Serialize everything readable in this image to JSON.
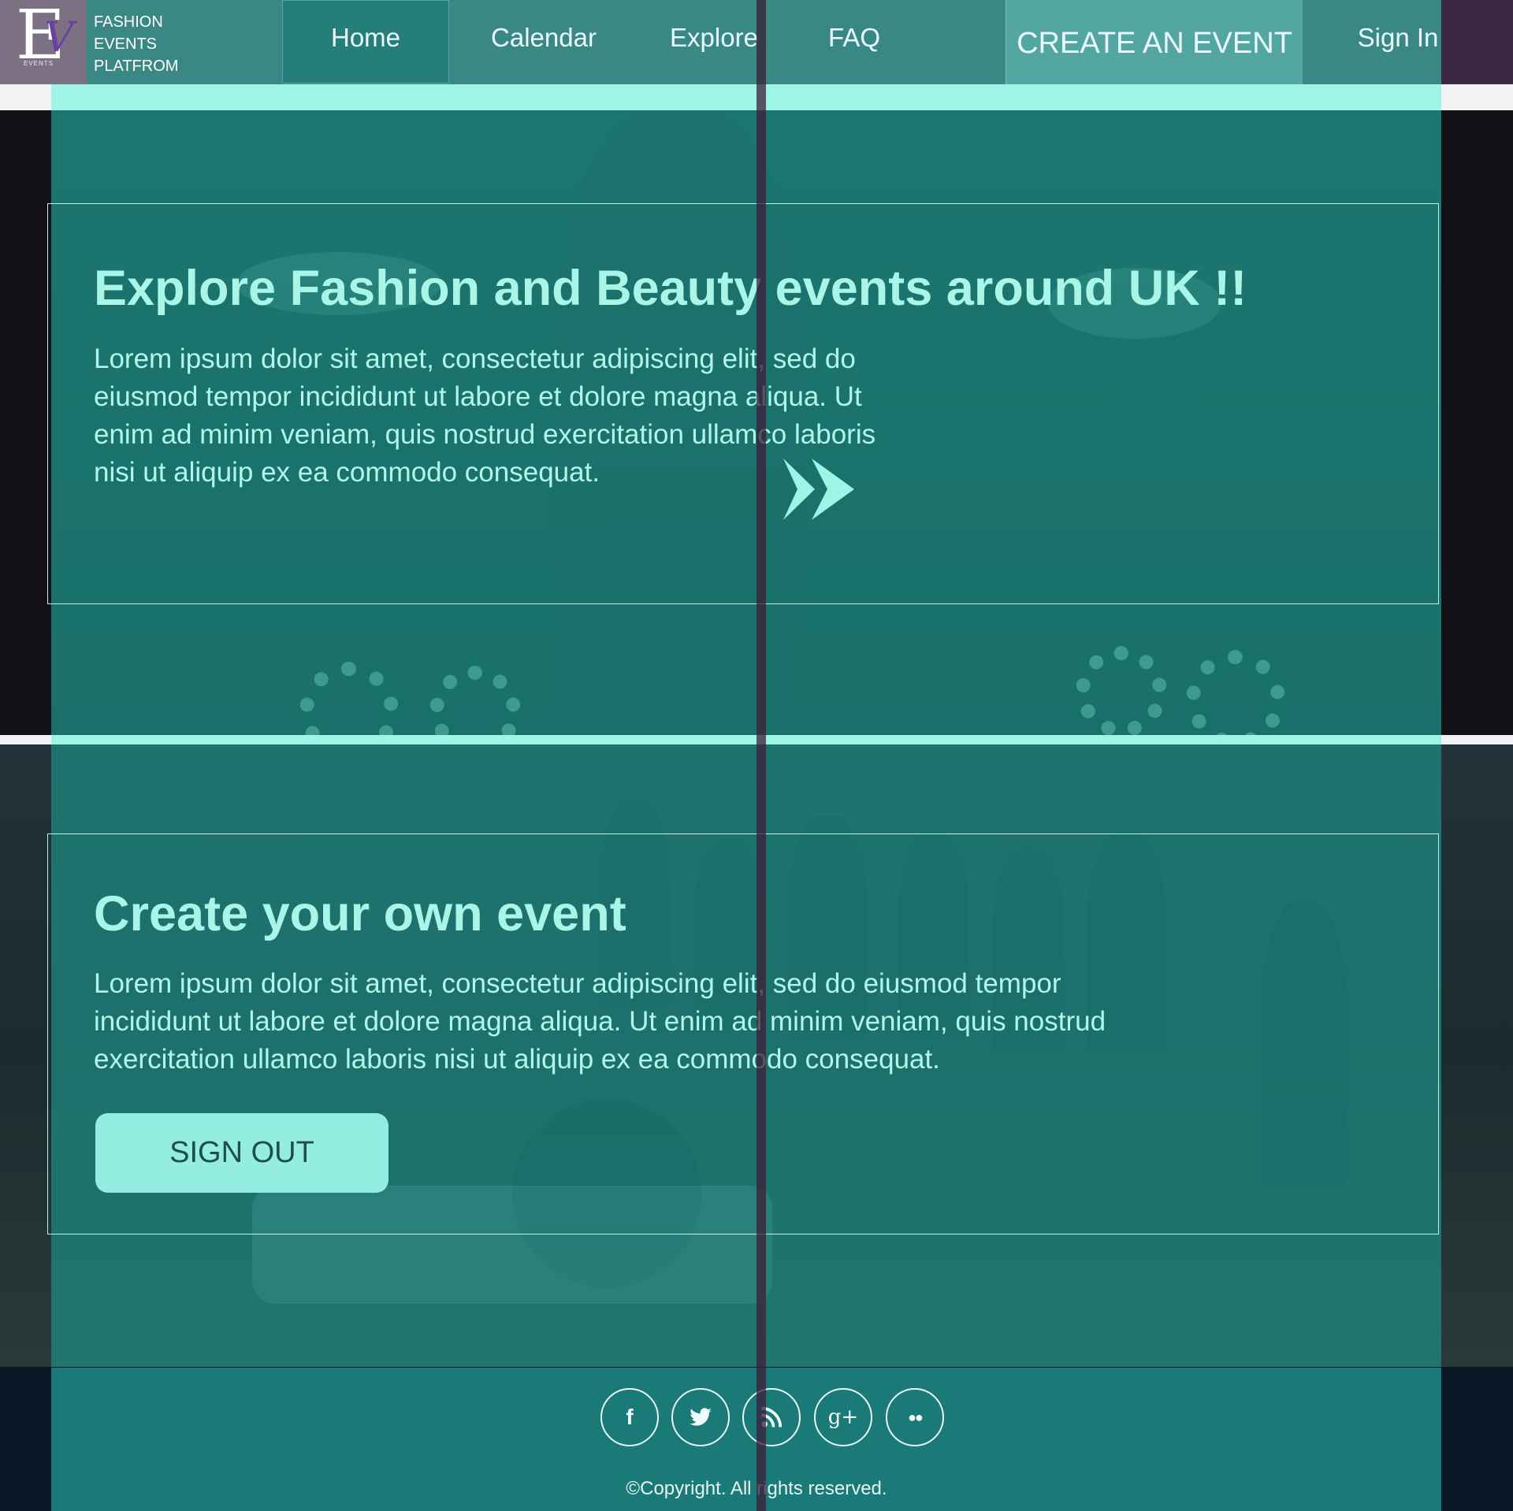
{
  "brand": {
    "logo_letters": "E",
    "logo_letter_v": "V",
    "logo_small": "EVENTS",
    "name_line1": "FASHION",
    "name_line2": "EVENTS",
    "name_line3": "PLATFROM"
  },
  "nav": {
    "home": "Home",
    "calendar": "Calendar",
    "explore": "Explore",
    "faq": "FAQ",
    "create": "CREATE AN EVENT",
    "signin": "Sign In"
  },
  "hero1": {
    "title": "Explore Fashion and Beauty events around UK !!",
    "body": "Lorem ipsum dolor sit amet, consectetur adipiscing elit, sed do eiusmod tempor incididunt ut labore et dolore magna aliqua. Ut enim ad minim veniam, quis nostrud exercitation ullamco laboris nisi ut aliquip ex ea commodo consequat.",
    "arrow_icon": "double-chevron-right-icon"
  },
  "hero2": {
    "title": "Create your own event",
    "body": "Lorem ipsum dolor sit amet, consectetur adipiscing elit, sed do eiusmod tempor incididunt ut labore et dolore magna aliqua. Ut enim ad minim veniam, quis nostrud exercitation ullamco laboris nisi ut aliquip ex ea commodo consequat.",
    "button": "SIGN OUT"
  },
  "footer": {
    "social": [
      {
        "icon": "facebook-icon",
        "glyph": "f"
      },
      {
        "icon": "twitter-icon",
        "glyph": "🐦"
      },
      {
        "icon": "rss-icon",
        "glyph": "◝"
      },
      {
        "icon": "google-plus-icon",
        "glyph": "g+"
      },
      {
        "icon": "flickr-icon",
        "glyph": "●●"
      }
    ],
    "copyright": "©Copyright. All rights reserved."
  },
  "colors": {
    "teal_overlay": "#1e8c84",
    "accent_aqua": "#9ef5e6",
    "nav_bg": "#3a8884",
    "footer_bg": "#1a7a77"
  }
}
